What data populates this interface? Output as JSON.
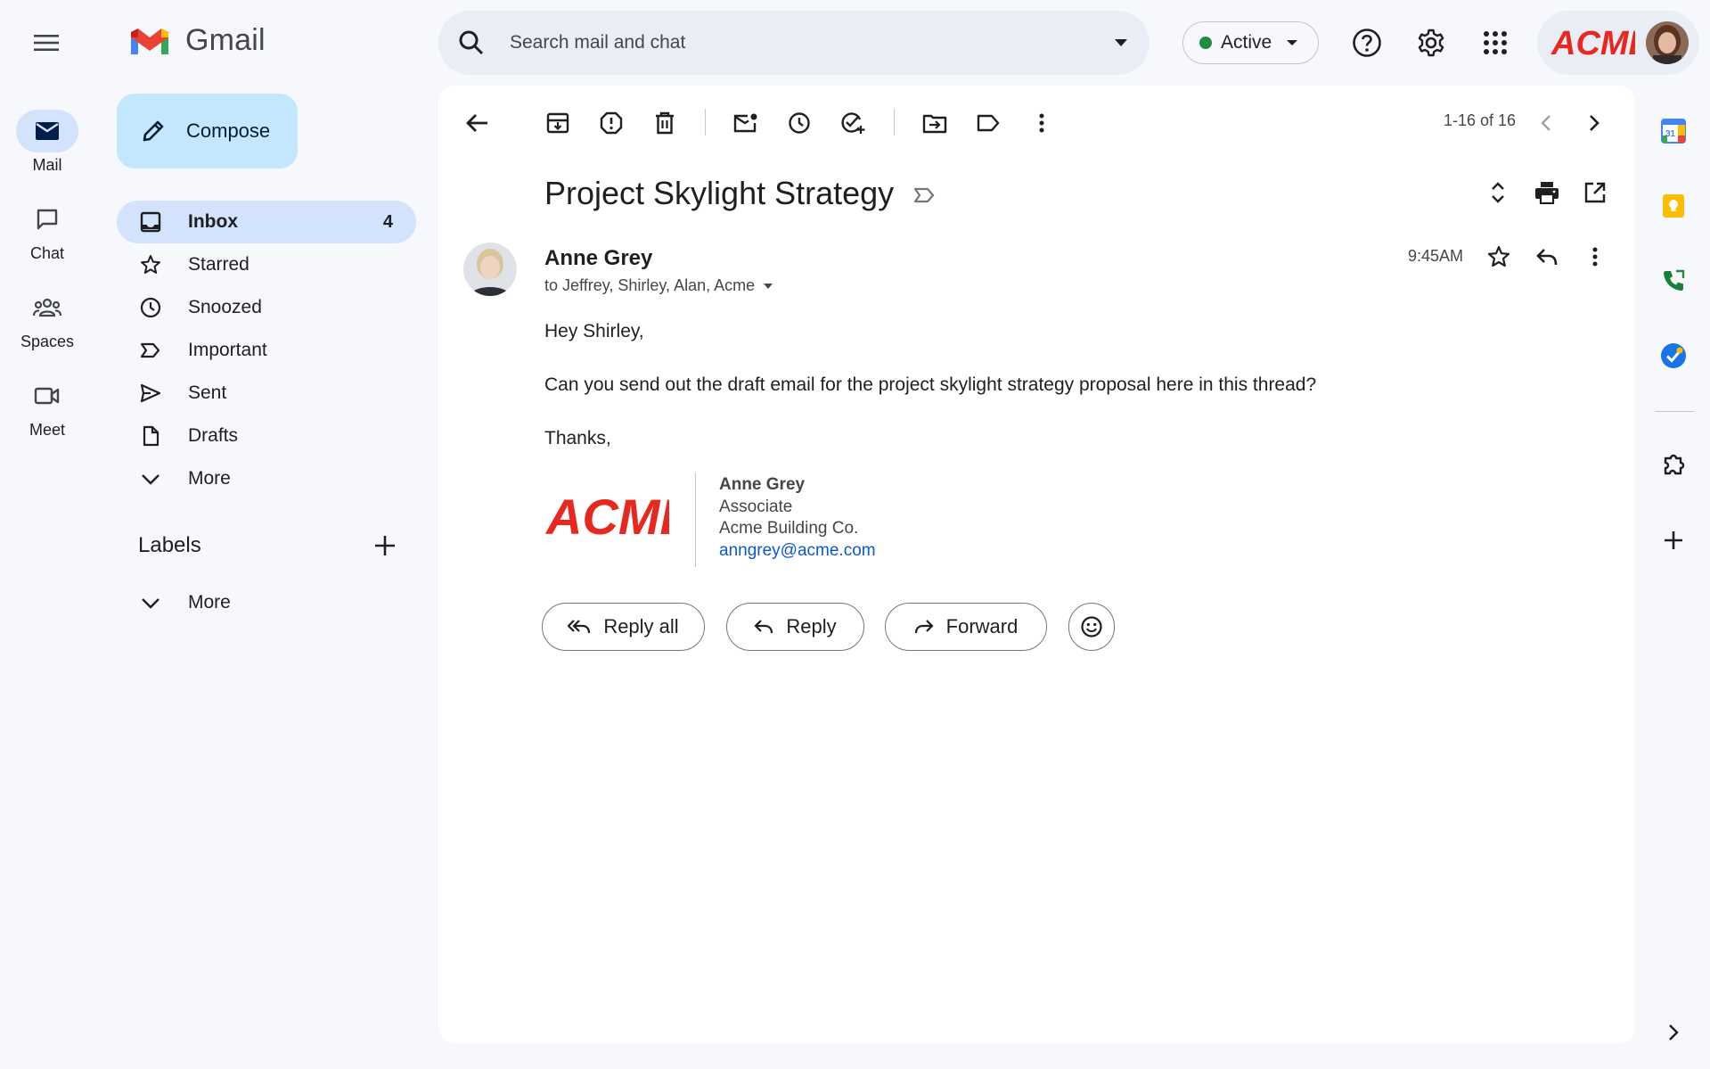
{
  "app": {
    "brand": "Gmail",
    "account_logo": "ACME"
  },
  "rail": {
    "items": [
      {
        "label": "Mail",
        "icon": "mail-icon",
        "active": true
      },
      {
        "label": "Chat",
        "icon": "chat-icon"
      },
      {
        "label": "Spaces",
        "icon": "spaces-icon"
      },
      {
        "label": "Meet",
        "icon": "meet-icon"
      }
    ]
  },
  "sidebar": {
    "compose_label": "Compose",
    "nav": [
      {
        "label": "Inbox",
        "icon": "inbox-icon",
        "count": "4",
        "active": true
      },
      {
        "label": "Starred",
        "icon": "star-icon"
      },
      {
        "label": "Snoozed",
        "icon": "clock-icon"
      },
      {
        "label": "Important",
        "icon": "important-icon"
      },
      {
        "label": "Sent",
        "icon": "send-icon"
      },
      {
        "label": "Drafts",
        "icon": "draft-icon"
      },
      {
        "label": "More",
        "icon": "chevron-down-icon"
      }
    ],
    "labels_heading": "Labels",
    "labels_more": "More"
  },
  "header": {
    "search_placeholder": "Search mail and chat",
    "status_label": "Active"
  },
  "toolbar": {
    "pager": "1-16 of 16"
  },
  "email": {
    "subject": "Project Skylight Strategy",
    "sender": "Anne Grey",
    "recipients": "to Jeffrey, Shirley, Alan, Acme",
    "time": "9:45AM",
    "greeting": "Hey Shirley,",
    "body": "Can you send out the draft email for the project skylight strategy proposal here in this thread?",
    "closing": "Thanks,",
    "signature": {
      "logo": "ACME",
      "name": "Anne Grey",
      "title": "Associate",
      "company": "Acme Building Co.",
      "email": "anngrey@acme.com"
    }
  },
  "actions": {
    "reply_all": "Reply all",
    "reply": "Reply",
    "forward": "Forward"
  },
  "colors": {
    "accent": "#0b57d0",
    "selected": "#d3e3fd",
    "compose": "#c2e7ff",
    "acme_red": "#e8271f"
  }
}
